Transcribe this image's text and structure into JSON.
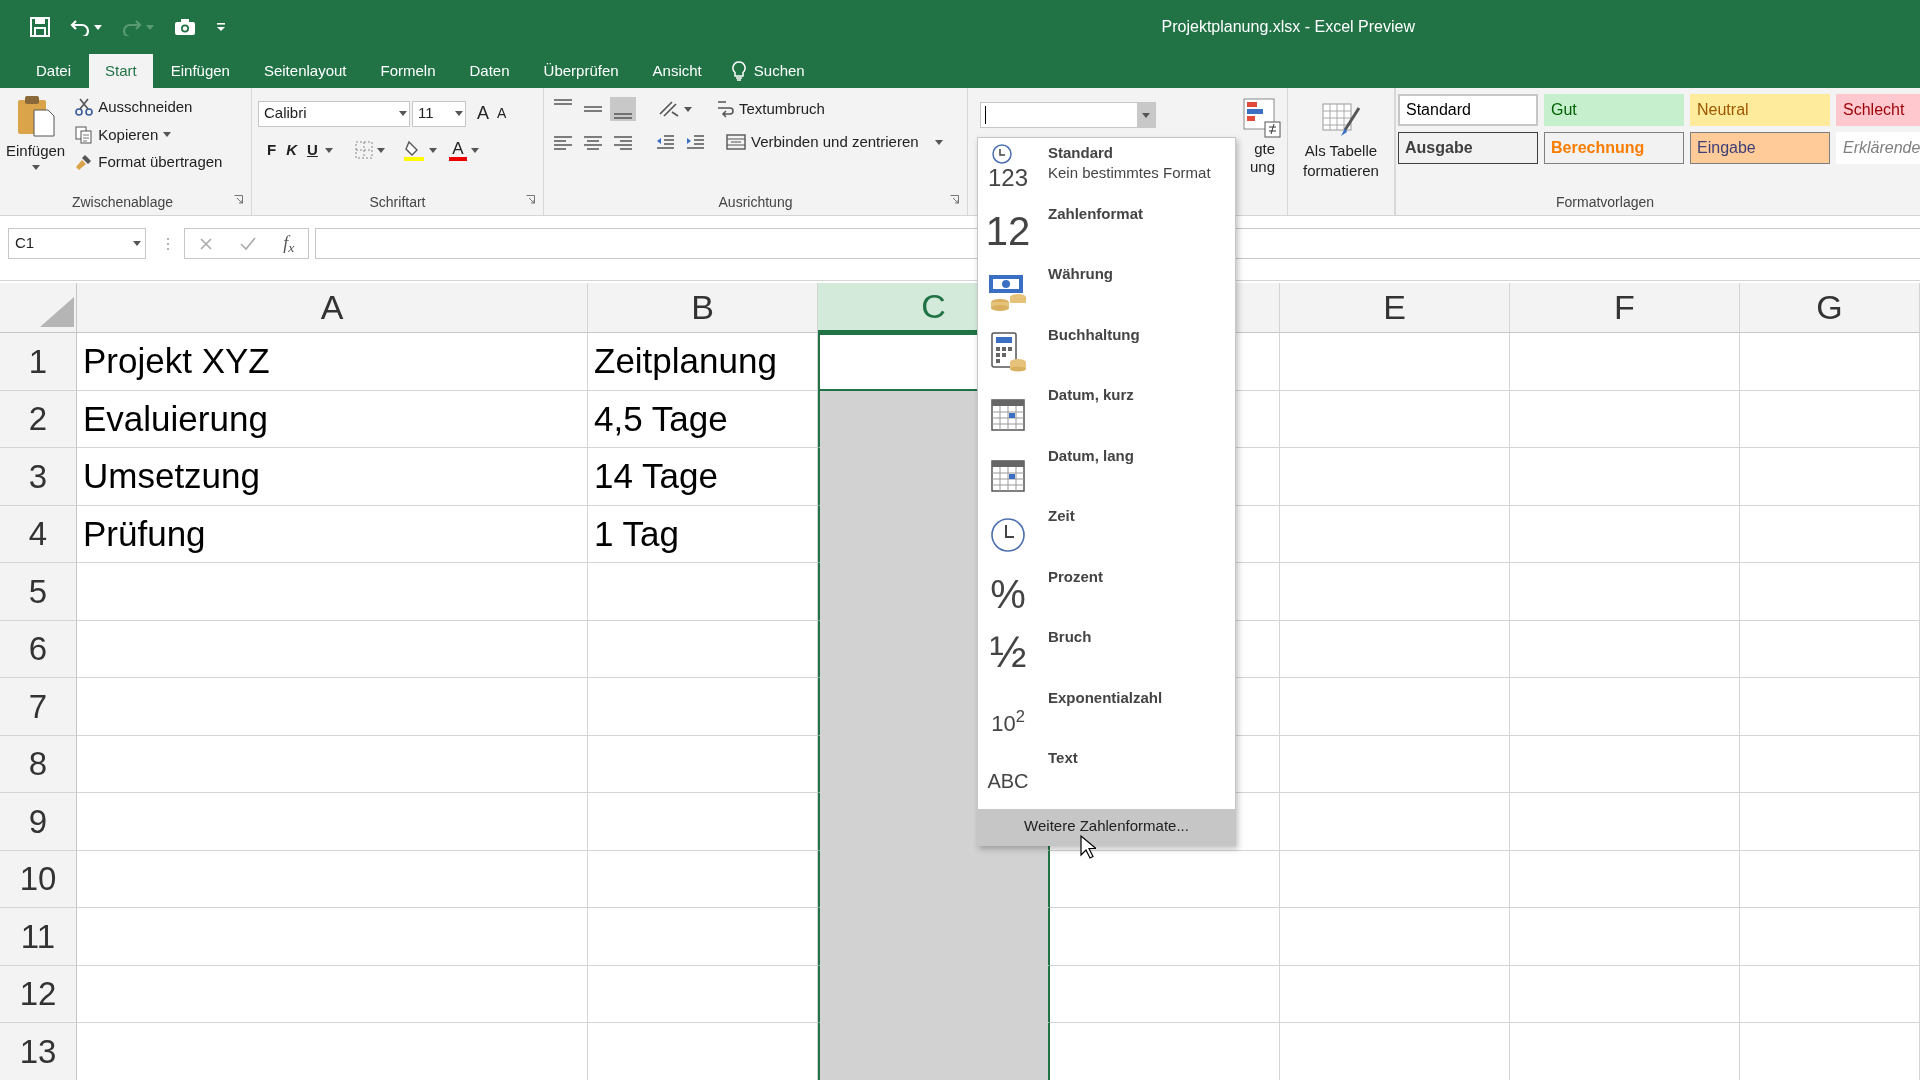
{
  "window": {
    "title": "Projektplanung.xlsx  -  Excel Preview"
  },
  "tabs": [
    {
      "label": "Datei",
      "selected": false
    },
    {
      "label": "Start",
      "selected": true
    },
    {
      "label": "Einfügen",
      "selected": false
    },
    {
      "label": "Seitenlayout",
      "selected": false
    },
    {
      "label": "Formeln",
      "selected": false
    },
    {
      "label": "Daten",
      "selected": false
    },
    {
      "label": "Überprüfen",
      "selected": false
    },
    {
      "label": "Ansicht",
      "selected": false
    }
  ],
  "tell_me": {
    "label": "Suchen"
  },
  "ribbon": {
    "clipboard": {
      "paste": "Einfügen",
      "cut": "Ausschneiden",
      "copy": "Kopieren",
      "format_painter": "Format übertragen",
      "group": "Zwischenablage"
    },
    "font": {
      "name": "Calibri",
      "size": "11",
      "grow": "A",
      "shrink": "A",
      "bold": "F",
      "italic": "K",
      "underline": "U",
      "font_color": "A",
      "group": "Schriftart"
    },
    "alignment": {
      "wrap": "Textumbruch",
      "merge": "Verbinden und zentrieren",
      "group": "Ausrichtung"
    },
    "conditional_formatting": {
      "line_1": "gte",
      "line_2": "ung"
    },
    "format_as_table": {
      "line_1": "Als Tabelle",
      "line_2": "formatieren"
    },
    "cell_styles": [
      {
        "label": "Standard",
        "kind": "normal"
      },
      {
        "label": "Gut",
        "kind": "good"
      },
      {
        "label": "Neutral",
        "kind": "neutral"
      },
      {
        "label": "Schlecht",
        "kind": "bad"
      },
      {
        "label": "Ausgabe",
        "kind": "output"
      },
      {
        "label": "Berechnung",
        "kind": "calculation"
      },
      {
        "label": "Eingabe",
        "kind": "input"
      },
      {
        "label": "Erklärende",
        "kind": "explanatory"
      }
    ],
    "styles_group": "Formatvorlagen"
  },
  "formula_bar": {
    "name_box": "C1",
    "function_label": "f$_{x}$"
  },
  "sheet": {
    "columns": [
      {
        "label": "A",
        "selected": false
      },
      {
        "label": "B",
        "selected": false
      },
      {
        "label": "C",
        "selected": true
      },
      {
        "selected": false
      },
      {
        "label": "E",
        "selected": false
      },
      {
        "label": "F",
        "selected": false
      },
      {
        "label": "G",
        "selected": false
      }
    ],
    "rows": [
      {
        "header": "1",
        "cells": [
          "Projekt XYZ",
          "Zeitplanung"
        ]
      },
      {
        "header": "2",
        "cells": [
          "Evaluierung",
          "4,5 Tage"
        ]
      },
      {
        "header": "3",
        "cells": [
          "Umsetzung",
          "14 Tage"
        ]
      },
      {
        "header": "4",
        "cells": [
          "Prüfung",
          "1 Tag"
        ]
      },
      {
        "header": "5"
      },
      {
        "header": "6"
      },
      {
        "header": "7"
      },
      {
        "header": "8"
      },
      {
        "header": "9"
      },
      {
        "header": "10"
      },
      {
        "header": "11"
      },
      {
        "header": "12"
      },
      {
        "header": "13"
      }
    ]
  },
  "number_format_menu": {
    "items": [
      {
        "label": "Standard",
        "description": "Kein bestimmtes Format",
        "kind": "general",
        "glyph": "123"
      },
      {
        "label": "Zahlenformat",
        "kind": "number",
        "glyph": "12"
      },
      {
        "label": "Währung",
        "kind": "currency"
      },
      {
        "label": "Buchhaltung",
        "kind": "accounting"
      },
      {
        "label": "Datum, kurz",
        "kind": "calendar"
      },
      {
        "label": "Datum, lang",
        "kind": "calendar"
      },
      {
        "label": "Zeit",
        "kind": "clock"
      },
      {
        "label": "Prozent",
        "kind": "percent",
        "glyph": "%"
      },
      {
        "label": "Bruch",
        "kind": "fraction",
        "glyph": "½"
      },
      {
        "label": "Exponentialzahl",
        "kind": "scientific",
        "glyph": "10$^{2}$"
      },
      {
        "label": "Text",
        "kind": "text",
        "glyph": "ABC"
      }
    ],
    "more": {
      "label": "Weitere Zahlenformate...",
      "selected": true
    }
  }
}
